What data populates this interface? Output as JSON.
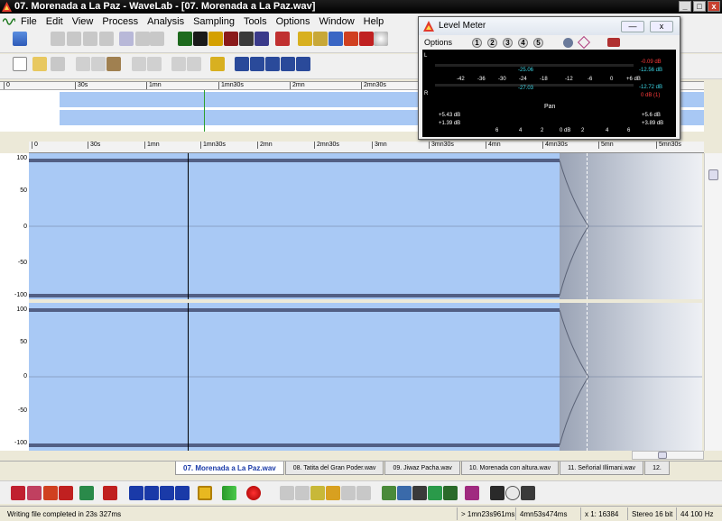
{
  "window": {
    "title": "07. Morenada a La Paz - WaveLab - [07. Morenada a La Paz.wav]"
  },
  "menu": [
    "File",
    "Edit",
    "View",
    "Process",
    "Analysis",
    "Sampling",
    "Tools",
    "Options",
    "Window",
    "Help"
  ],
  "ruler": {
    "ticks": [
      "0",
      "30s",
      "1mn",
      "1mn30s",
      "2mn",
      "2mn30s",
      "3mn",
      "3mn30s",
      "4mn",
      "4mn30s",
      "5mn",
      "5mn30s"
    ]
  },
  "overview_ruler": {
    "ticks": [
      "0",
      "30s",
      "1mn",
      "1mn30s",
      "2mn",
      "2mn30s"
    ]
  },
  "scale": {
    "top": [
      "100",
      "50",
      "0",
      "-50",
      "-100"
    ],
    "bottom": [
      "100",
      "50",
      "0",
      "-50",
      "-100"
    ]
  },
  "tabs": {
    "active": "07. Morenada a La Paz.wav",
    "items": [
      "08. Tatita del Gran Poder.wav",
      "09. Jiwaz Pacha.wav",
      "10. Morenada con altura.wav",
      "11. Señorial Illimani.wav",
      "12."
    ]
  },
  "status": {
    "message": "Writing file completed in 23s 327ms",
    "cursor": "> 1mn23s961ms",
    "length": "4mn53s474ms",
    "zoom": "x 1: 16384",
    "format": "Stereo 16 bit",
    "rate": "44 100 Hz"
  },
  "level_meter": {
    "title": "Level Meter",
    "options_label": "Options",
    "channel_l": "L",
    "channel_r": "R",
    "presets": [
      "1",
      "2",
      "3",
      "4",
      "5"
    ],
    "scale": [
      "-42",
      "-36",
      "-30",
      "-24",
      "-18",
      "-12",
      "-6",
      "0",
      "+6 dB"
    ],
    "l_peak": "-25.06",
    "r_peak": "-27.03",
    "l_right_top": "-0.09 dB",
    "l_right_bottom": "-12.56 dB",
    "r_right_top": "-12.72 dB",
    "r_right_bottom": "0 dB (1)",
    "pan_label": "Pan",
    "pan_left_top": "+5.43 dB",
    "pan_left_bottom": "+1.39 dB",
    "pan_right_top": "+5.6 dB",
    "pan_right_bottom": "+3.89 dB",
    "pan_scale": [
      "6",
      "4",
      "2",
      "0 dB",
      "2",
      "4",
      "6"
    ]
  },
  "colors": {
    "waveform": "#a9c9f5",
    "accent": "#1a3aa8",
    "peak_red": "#ff3b3b",
    "peak_cyan": "#3dd8e8"
  }
}
